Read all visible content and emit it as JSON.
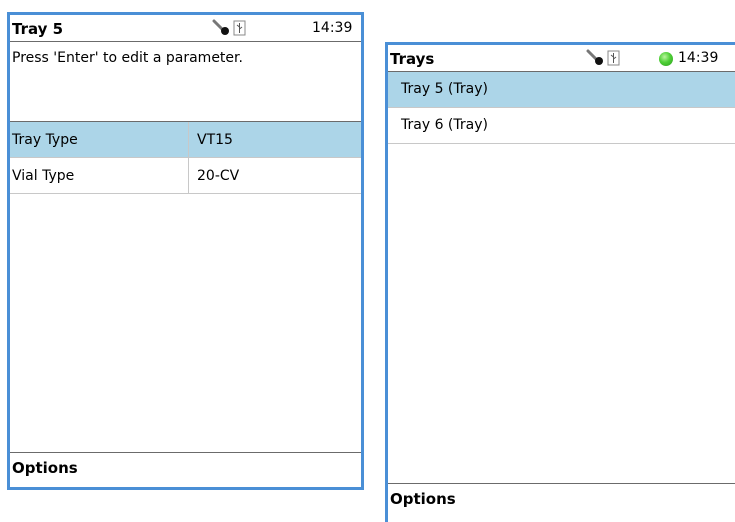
{
  "left_panel": {
    "title": "Tray 5",
    "time": "14:39",
    "message": "Press 'Enter' to edit a parameter.",
    "rows": [
      {
        "label": "Tray Type",
        "value": "VT15"
      },
      {
        "label": "Vial Type",
        "value": "20-CV"
      }
    ],
    "footer": "Options"
  },
  "right_panel": {
    "title": "Trays",
    "time": "14:39",
    "items": [
      {
        "label": "Tray 5 (Tray)"
      },
      {
        "label": "Tray 6 (Tray)"
      }
    ],
    "footer": "Options"
  },
  "status_icons": [
    "key-icon",
    "usb-icon"
  ],
  "colors": {
    "panel_border": "#4a8fd6",
    "selection": "#acd5e8",
    "led": "#4fcf37"
  }
}
